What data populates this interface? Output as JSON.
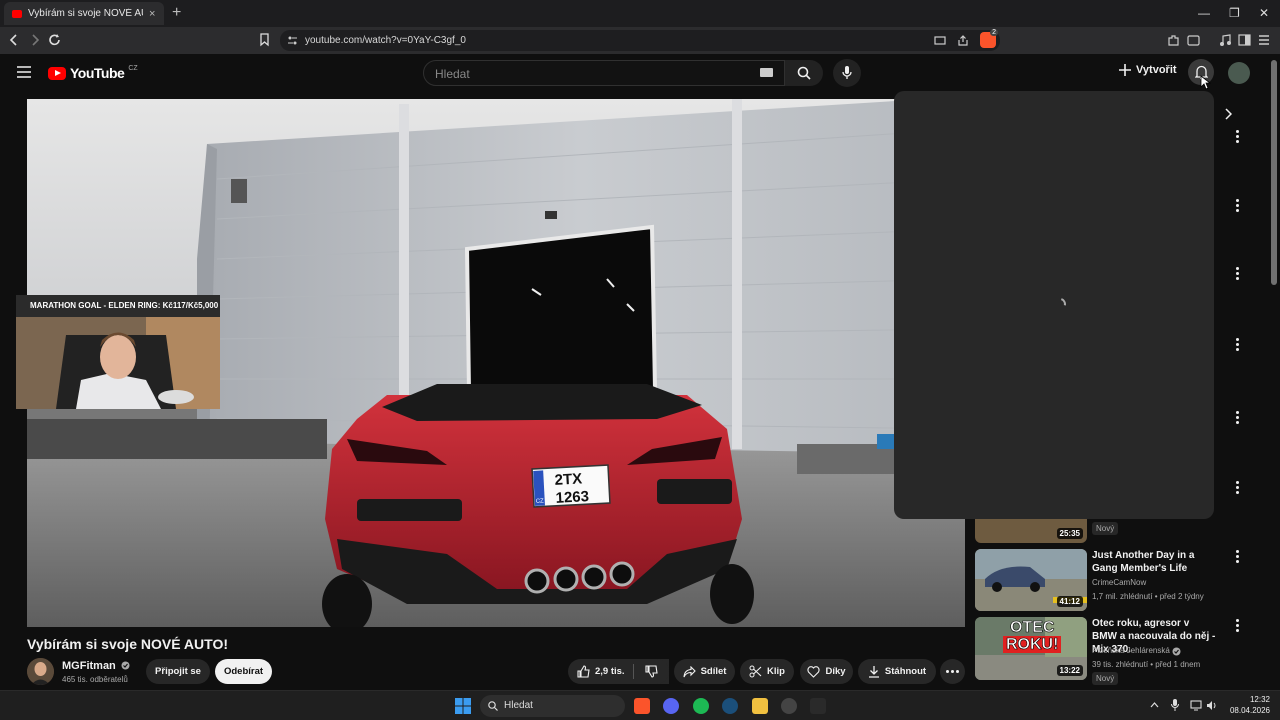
{
  "browser": {
    "tab_title": "Vybírám si svoje NOVÉ AUTO! - YouTube",
    "tab_close": "×",
    "new_tab": "+",
    "url": "youtube.com/watch?v=0YaY-C3gf_0",
    "extension_badge": "2",
    "window_minimize": "—",
    "window_restore": "❐",
    "window_close": "✕"
  },
  "youtube": {
    "logo_text": "YouTube",
    "country_code": "CZ",
    "search_placeholder": "Hledat",
    "create_label": "Vytvořit"
  },
  "video": {
    "title": "Vybírám si svoje NOVÉ AUTO!",
    "overlay_text": "MARATHON GOAL - ELDEN RING: Kč117/Kč5,000",
    "plate_line1": "2TX",
    "plate_line2": "1263",
    "plate_country": "CZ"
  },
  "channel": {
    "name": "MGFitman",
    "subscribers": "465 tis. odběratelů",
    "join_label": "Připojit se",
    "subscribe_label": "Odebírat"
  },
  "actions": {
    "likes": "2,9 tis.",
    "share": "Sdílet",
    "clip": "Klip",
    "thanks": "Díky",
    "download": "Stáhnout"
  },
  "recommendations": [
    {
      "duration": "25:35",
      "badge": "Nový"
    },
    {
      "title": "Just Another Day in a Gang Member's Life",
      "channel": "CrimeCamNow",
      "meta": "1,7 mil. zhlédnutí • před 2 týdny",
      "duration": "41:12"
    },
    {
      "title": "Otec roku, agresor v BMW a nacouvala do něj - Mix 370.",
      "channel": "Plzeňská Jehlárenská",
      "meta": "39 tis. zhlédnutí • před 1 dnem",
      "duration": "13:22",
      "badge": "Nový",
      "thumb_text_1": "OTEC",
      "thumb_text_2": "ROKU!"
    }
  ],
  "taskbar": {
    "search_label": "Hledat",
    "time": "12:32",
    "date": "08.04.2026"
  },
  "colors": {
    "youtube_red": "#ff0000",
    "background": "#0f0f0f",
    "car_red": "#b3202a"
  }
}
